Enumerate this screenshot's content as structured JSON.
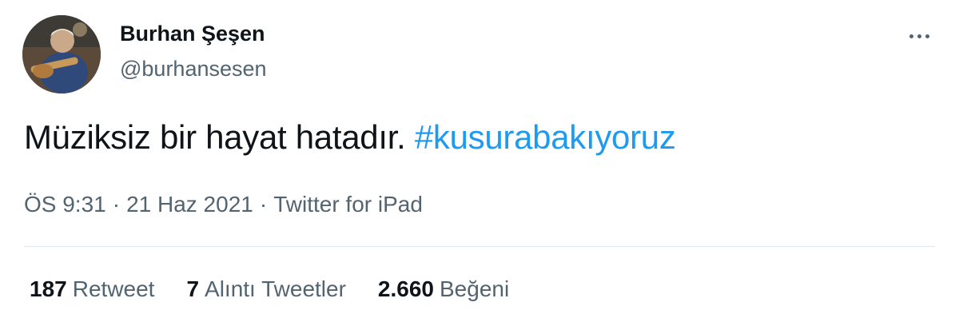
{
  "author": {
    "name": "Burhan Şeşen",
    "handle": "@burhansesen"
  },
  "tweet": {
    "text": "Müziksiz bir hayat hatadır.",
    "hashtag": "#kusurabakıyoruz"
  },
  "meta": {
    "time": "ÖS 9:31",
    "separator": "·",
    "date": "21 Haz 2021",
    "source": "Twitter for iPad"
  },
  "stats": {
    "retweets": {
      "count": "187",
      "label": "Retweet"
    },
    "quotes": {
      "count": "7",
      "label": "Alıntı Tweetler"
    },
    "likes": {
      "count": "2.660",
      "label": "Beğeni"
    }
  },
  "icons": {
    "more": "more-horizontal-icon"
  },
  "colors": {
    "link": "#1d9bf0",
    "secondary_text": "#536471",
    "primary_text": "#0f1419",
    "divider": "#e1e8ed"
  }
}
